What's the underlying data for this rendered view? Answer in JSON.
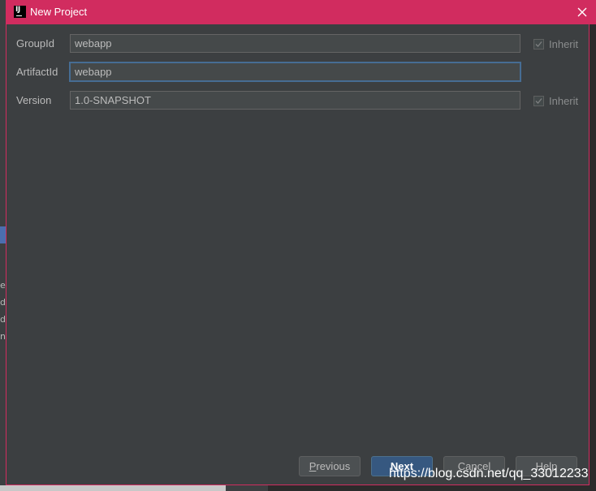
{
  "window": {
    "title": "New Project",
    "icon_text": "IJ"
  },
  "form": {
    "group_id": {
      "label": "GroupId",
      "value": "webapp",
      "inherit_label": "Inherit",
      "inherit_checked": true
    },
    "artifact_id": {
      "label": "ArtifactId",
      "value": "webapp"
    },
    "version": {
      "label": "Version",
      "value": "1.0-SNAPSHOT",
      "inherit_label": "Inherit",
      "inherit_checked": true
    }
  },
  "buttons": {
    "previous": {
      "label": "Previous",
      "mnemonic": "P",
      "rest": "revious"
    },
    "next": {
      "label": "Next",
      "mnemonic": "N",
      "rest": "ext"
    },
    "cancel": {
      "label": "Cancel"
    },
    "help": {
      "label": "Help"
    }
  },
  "watermark": "https://blog.csdn.net/qq_33012233",
  "colors": {
    "titlebar": "#d12c5f",
    "dialog_bg": "#3c3f41",
    "field_bg": "#45494a",
    "focus_border": "#466d94",
    "primary_button": "#365880"
  },
  "background_fragments": [
    "e",
    "d",
    "d",
    "n"
  ]
}
